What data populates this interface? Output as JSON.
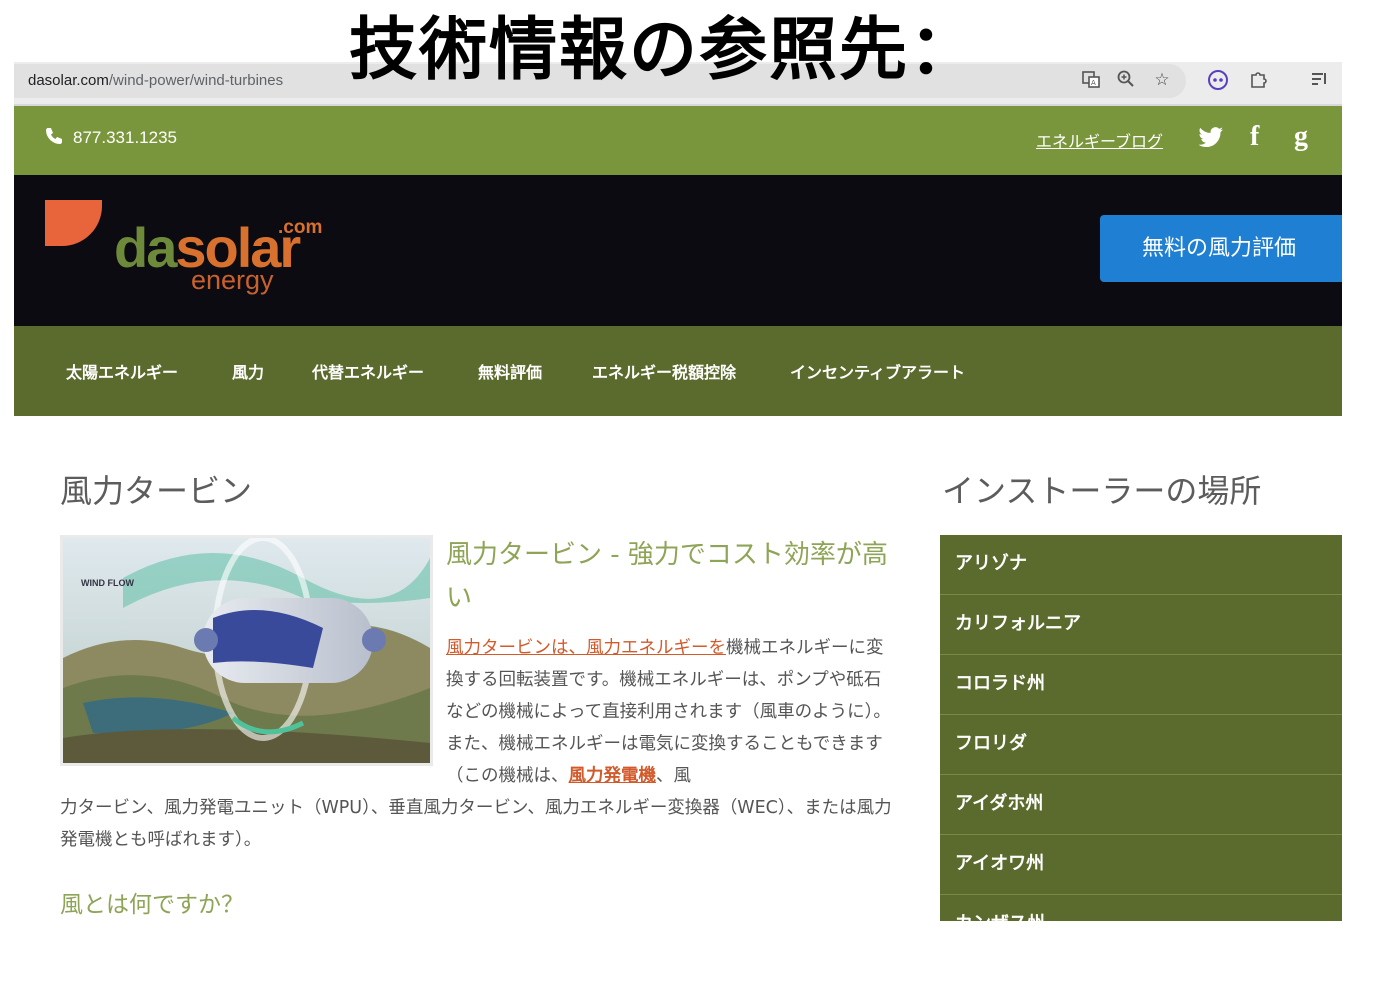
{
  "caption": "技術情報の参照先：",
  "browser": {
    "url_host": "dasolar.com",
    "url_path": "/wind-power/wind-turbines",
    "icons": [
      "translate-icon",
      "zoom-icon",
      "star-icon",
      "extension-face-icon",
      "puzzle-icon",
      "reading-list-icon"
    ]
  },
  "topbar": {
    "phone": "877.331.1235",
    "blog_link": "エネルギーブログ",
    "social": {
      "twitter": "🐦",
      "facebook": "f",
      "google": "g"
    }
  },
  "header": {
    "logo_da": "da",
    "logo_solar": "solar",
    "logo_com": ".com",
    "logo_energy": "energy",
    "cta_label": "無料の風力評価"
  },
  "nav": {
    "items": [
      "太陽エネルギー",
      "風力",
      "代替エネルギー",
      "無料評価",
      "エネルギー税額控除",
      "インセンティブアラート"
    ]
  },
  "main": {
    "page_title": "風力タービン",
    "image_label": "WIND FLOW",
    "article_title": "風力タービン - 強力でコスト効率が高い",
    "link1": "風力タービンは、風力エネルギーを",
    "text1": "機械エネルギーに変換する回転装置です。機械エネルギーは、ポンプや砥石などの機械によって直接利用されます（風車のように）。また、機械エネルギーは電気に変換することもできます（この機械は、",
    "link2": "風力発電機",
    "text2a": "、風",
    "text2b": "力タービン、風力発電ユニット（WPU）、垂直風力タービン、風力エネルギー変換器（WEC）、または風力発電機とも呼ばれます）。",
    "sub_heading": "風とは何ですか？"
  },
  "sidebar": {
    "title": "インストーラーの場所",
    "items": [
      "アリゾナ",
      "カリフォルニア",
      "コロラド州",
      "フロリダ",
      "アイダホ州",
      "アイオワ州",
      "カンザス州"
    ]
  }
}
